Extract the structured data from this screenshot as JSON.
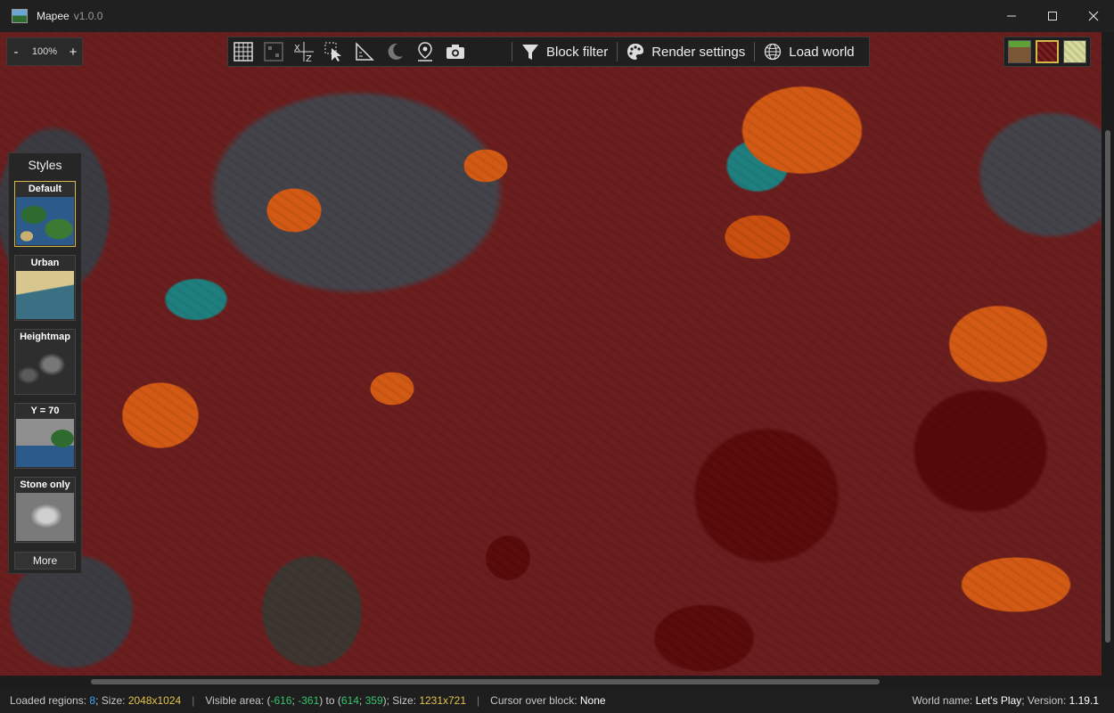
{
  "window": {
    "title": "Mapee",
    "version": "v1.0.0",
    "controls": {
      "minimize": "minimize-icon",
      "maximize": "maximize-icon",
      "close": "close-icon"
    }
  },
  "zoom": {
    "minus": "-",
    "value": "100%",
    "plus": "+"
  },
  "toolbar": {
    "icons": [
      "grid-icon",
      "chunk-grid-icon",
      "coordinates-icon",
      "select-area-icon",
      "measure-icon",
      "night-mode-icon",
      "location-pin-icon",
      "camera-icon"
    ],
    "block_filter": "Block filter",
    "render_settings": "Render settings",
    "load_world": "Load world"
  },
  "dimensions": [
    {
      "name": "overworld",
      "active": false
    },
    {
      "name": "nether",
      "active": true
    },
    {
      "name": "end",
      "active": false
    }
  ],
  "styles": {
    "title": "Styles",
    "items": [
      {
        "label": "Default",
        "active": true
      },
      {
        "label": "Urban",
        "active": false
      },
      {
        "label": "Heightmap",
        "active": false
      },
      {
        "label": "Y = 70",
        "active": false
      },
      {
        "label": "Stone only",
        "active": false
      }
    ],
    "more": "More"
  },
  "status": {
    "loaded_regions_label": "Loaded regions:",
    "loaded_regions": "8",
    "size_label": "; Size:",
    "size": "2048x1024",
    "visible_area_label": "Visible area: (",
    "va_x1": "-616",
    "va_y1": "-361",
    "to_label": ") to (",
    "va_x2": "614",
    "va_y2": "359",
    "va_size_label": "); Size:",
    "va_size": "1231x721",
    "cursor_label": "Cursor over block:",
    "cursor_block": "None",
    "world_name_label": "World name:",
    "world_name": "Let's Play",
    "version_label": "; Version:",
    "version": "1.19.1"
  },
  "colors": {
    "accent": "#d7b84a",
    "lava": "#d25a14",
    "netherrack": "#6a1e1e",
    "basalt": "#44434a",
    "warped": "#1f7f7f"
  }
}
